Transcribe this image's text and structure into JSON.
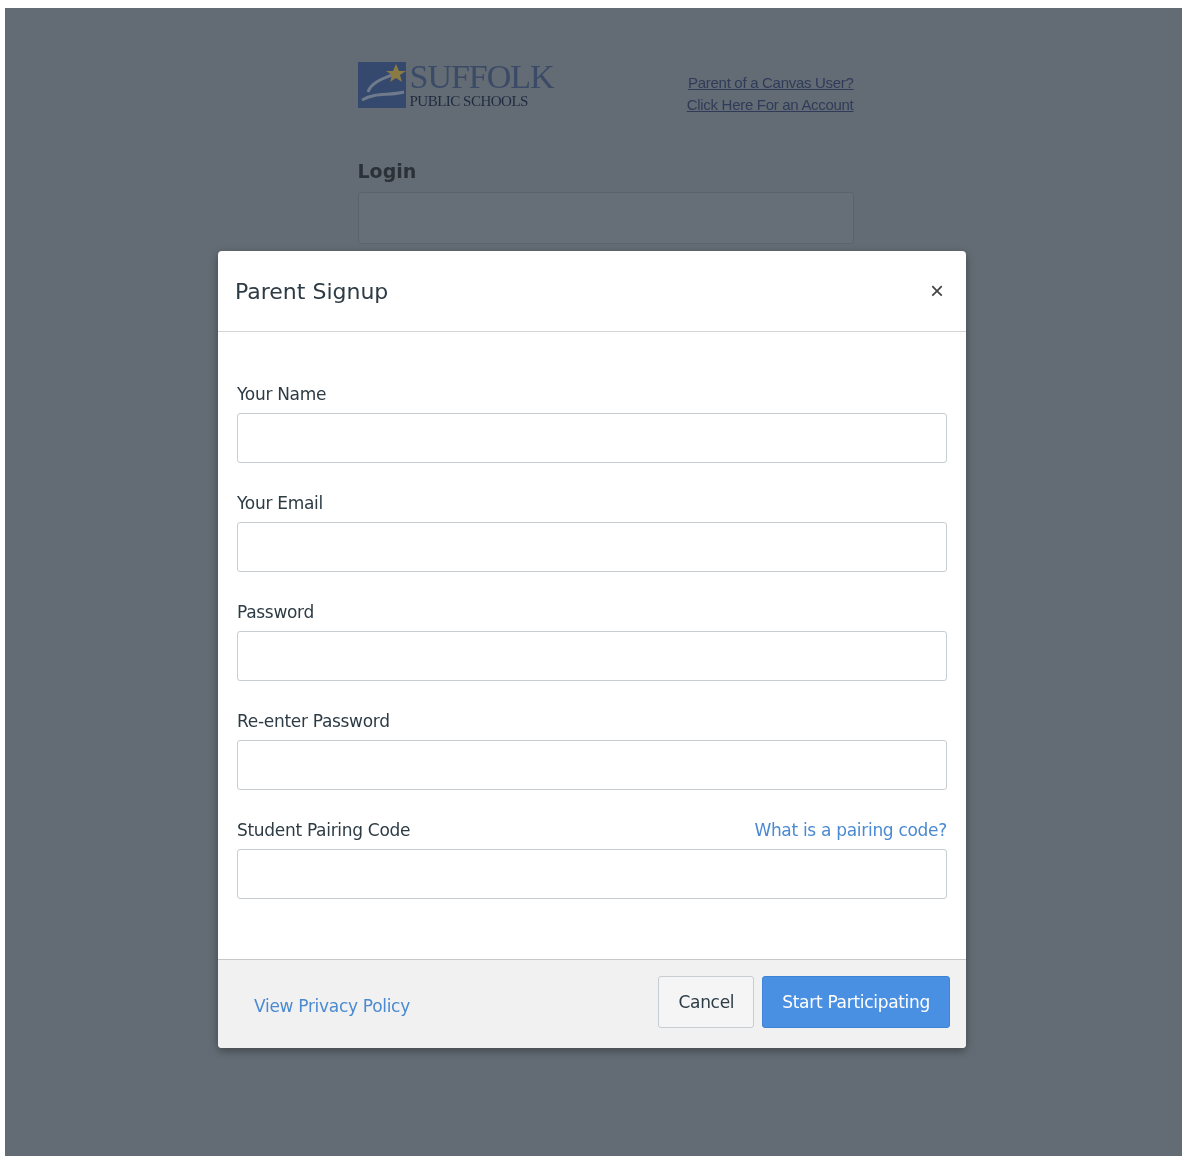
{
  "background_page": {
    "logo": {
      "name": "SUFFOLK",
      "subtitle": "PUBLIC SCHOOLS"
    },
    "signup_links": [
      "Parent of a Canvas User?",
      "Click Here For an Account"
    ],
    "login": {
      "label": "Login"
    }
  },
  "modal": {
    "title": "Parent Signup",
    "close": "×",
    "fields": [
      {
        "label": "Your Name"
      },
      {
        "label": "Your Email"
      },
      {
        "label": "Password"
      },
      {
        "label": "Re-enter Password"
      },
      {
        "label": "Student Pairing Code",
        "help_link": "What is a pairing code?"
      }
    ],
    "footer": {
      "privacy_link": "View Privacy Policy",
      "buttons": [
        {
          "label": "Cancel",
          "kind": "secondary"
        },
        {
          "label": "Start Participating",
          "kind": "primary"
        }
      ]
    }
  }
}
